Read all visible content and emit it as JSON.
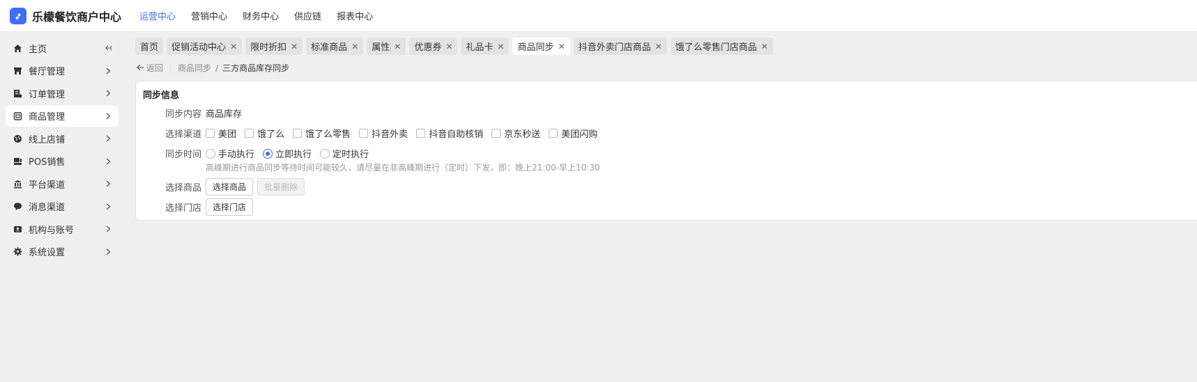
{
  "header": {
    "brand": "乐檬餐饮商户中心",
    "nav": [
      {
        "label": "运营中心",
        "active": true
      },
      {
        "label": "营销中心"
      },
      {
        "label": "财务中心"
      },
      {
        "label": "供应链"
      },
      {
        "label": "报表中心"
      }
    ]
  },
  "sidebar": {
    "items": [
      {
        "label": "主页",
        "icon": "home-icon"
      },
      {
        "label": "餐厅管理",
        "icon": "store-icon"
      },
      {
        "label": "订单管理",
        "icon": "order-icon"
      },
      {
        "label": "商品管理",
        "icon": "goods-icon",
        "active": true
      },
      {
        "label": "线上店铺",
        "icon": "globe-icon"
      },
      {
        "label": "POS销售",
        "icon": "pos-icon"
      },
      {
        "label": "平台渠道",
        "icon": "bank-icon"
      },
      {
        "label": "消息渠道",
        "icon": "message-icon"
      },
      {
        "label": "机构与账号",
        "icon": "account-icon"
      },
      {
        "label": "系统设置",
        "icon": "gear-icon"
      }
    ]
  },
  "tabs": [
    {
      "label": "首页",
      "closable": false
    },
    {
      "label": "促销活动中心",
      "closable": true
    },
    {
      "label": "限时折扣",
      "closable": true
    },
    {
      "label": "标准商品",
      "closable": true
    },
    {
      "label": "属性",
      "closable": true
    },
    {
      "label": "优惠券",
      "closable": true
    },
    {
      "label": "礼品卡",
      "closable": true
    },
    {
      "label": "商品同步",
      "closable": true,
      "active": true
    },
    {
      "label": "抖音外卖门店商品",
      "closable": true
    },
    {
      "label": "饿了么零售门店商品",
      "closable": true
    }
  ],
  "breadcrumb": {
    "back": "返回",
    "parent": "商品同步",
    "sep": "/",
    "current": "三方商品库存同步"
  },
  "sync": {
    "title": "同步信息",
    "content_label": "同步内容",
    "content_value": "商品库存",
    "channel_label": "选择渠道",
    "channels": [
      "美团",
      "饿了么",
      "饿了么零售",
      "抖音外卖",
      "抖音自助核销",
      "京东秒送",
      "美团闪购"
    ],
    "time_label": "同步时间",
    "time_options": [
      {
        "label": "手动执行",
        "checked": false
      },
      {
        "label": "立即执行",
        "checked": true
      },
      {
        "label": "定时执行",
        "checked": false
      }
    ],
    "hint": "高峰期进行商品同步等待时间可能较久，请尽量在非高峰期进行（定时）下发，即：晚上21:00-早上10:30",
    "goods_label": "选择商品",
    "goods_button": "选择商品",
    "batch_delete_button": "批量删除",
    "store_label": "选择门店",
    "store_button": "选择门店"
  },
  "colors": {
    "accent": "#3f6ff5",
    "background": "#f0f0f0"
  }
}
